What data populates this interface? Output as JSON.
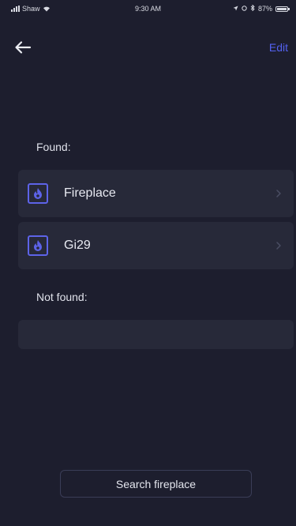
{
  "status_bar": {
    "carrier": "Shaw",
    "time": "9:30 AM",
    "battery": "87%"
  },
  "nav": {
    "back_icon": "arrow-left-icon",
    "edit_label": "Edit"
  },
  "found": {
    "label": "Found:",
    "items": [
      {
        "name": "Fireplace",
        "icon": "flame-icon"
      },
      {
        "name": "Gi29",
        "icon": "flame-icon"
      }
    ]
  },
  "not_found": {
    "label": "Not found:",
    "items": []
  },
  "actions": {
    "search_label": "Search fireplace"
  },
  "colors": {
    "background": "#1d1e2e",
    "card": "#272939",
    "accent": "#5361f0",
    "text": "#e4e6ee"
  }
}
